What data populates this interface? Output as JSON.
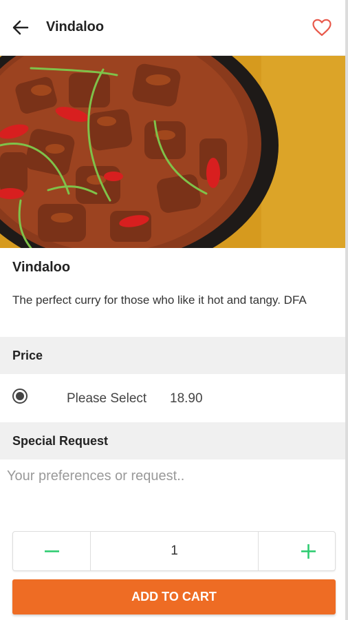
{
  "header": {
    "title": "Vindaloo",
    "back_icon": "arrow-left-icon",
    "favorite_icon": "heart-outline-icon"
  },
  "hero": {
    "alt": "Vindaloo curry in a black bowl"
  },
  "dish": {
    "name": "Vindaloo",
    "description": "The perfect curry for those who like it hot and tangy. DFA"
  },
  "price_section": {
    "heading": "Price",
    "option_label": "Please Select",
    "option_value": "18.90",
    "selected": true
  },
  "special_request": {
    "heading": "Special Request",
    "placeholder": "Your preferences or request..",
    "value": ""
  },
  "quantity": {
    "value": "1",
    "minus_icon": "minus-icon",
    "plus_icon": "plus-icon"
  },
  "cart": {
    "add_label": "ADD TO CART"
  },
  "colors": {
    "accent": "#ee6c24",
    "stepper": "#2ecc71",
    "heart": "#e8584a"
  }
}
